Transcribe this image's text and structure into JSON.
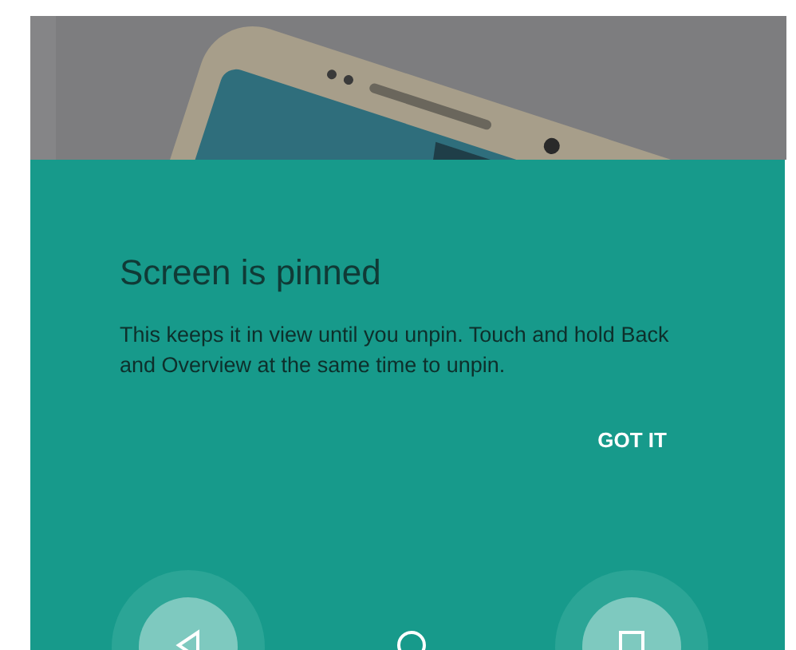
{
  "dialog": {
    "title": "Screen is pinned",
    "message": "This keeps it in view until you unpin. Touch and hold Back and Overview at the same time to unpin.",
    "button": "GOT IT"
  },
  "nav_bar": [
    {
      "kind": "back",
      "highlighted": true
    },
    {
      "kind": "home",
      "highlighted": false
    },
    {
      "kind": "overview",
      "highlighted": true
    }
  ]
}
